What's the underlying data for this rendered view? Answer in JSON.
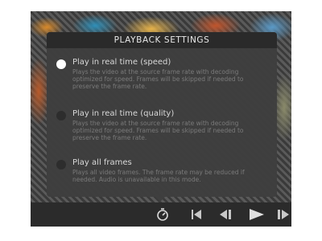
{
  "panel": {
    "title": "PLAYBACK SETTINGS",
    "options": [
      {
        "title": "Play in real time (speed)",
        "description": "Plays the video at the source frame rate with decoding optimized for speed. Frames will be skipped if needed to preserve the frame rate.",
        "selected": true
      },
      {
        "title": "Play in real time (quality)",
        "description": "Plays the video at the source frame rate with decoding optimized for speed. Frames will be skipped if needed to preserve the frame rate.",
        "selected": false
      },
      {
        "title": "Play all frames",
        "description": "Plays all video frames. The frame rate may be reduced if needed. Audio is unavailable in this mode.",
        "selected": false
      }
    ]
  },
  "controls": {
    "icons": [
      "playback-settings-icon",
      "skip-to-start-icon",
      "step-back-icon",
      "play-icon",
      "step-forward-icon"
    ]
  }
}
